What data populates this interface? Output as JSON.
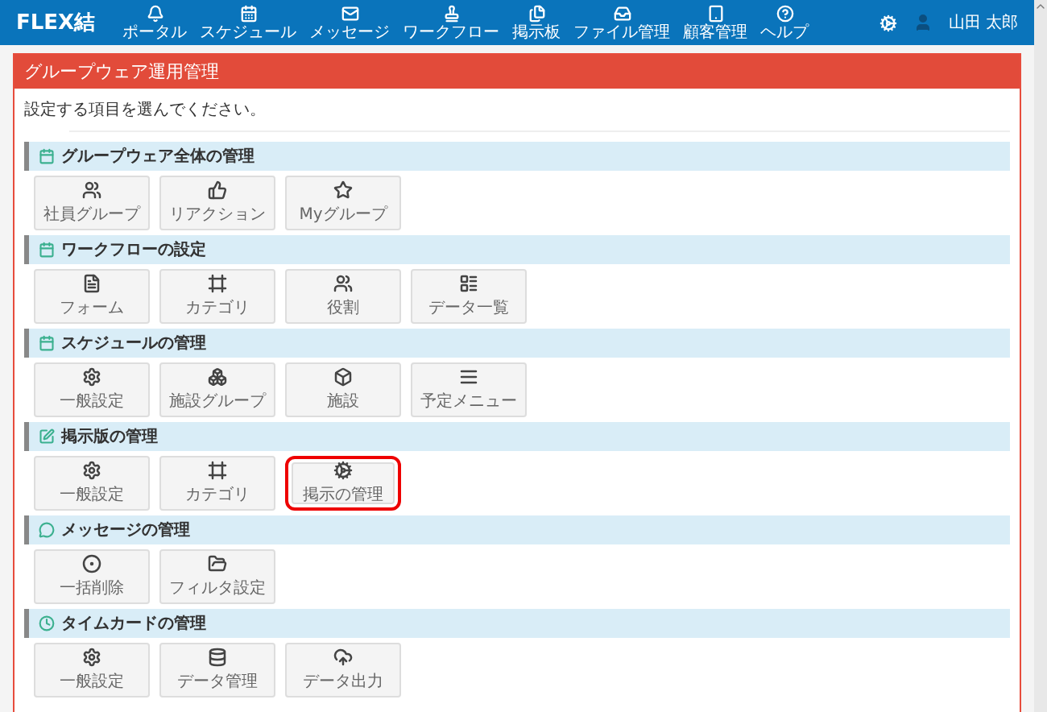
{
  "app": {
    "logo": "FLEX結",
    "user": "山田 太郎"
  },
  "nav": [
    {
      "label": "ポータル"
    },
    {
      "label": "スケジュール"
    },
    {
      "label": "メッセージ"
    },
    {
      "label": "ワークフロー"
    },
    {
      "label": "掲示板"
    },
    {
      "label": "ファイル管理"
    },
    {
      "label": "顧客管理"
    },
    {
      "label": "ヘルプ"
    }
  ],
  "panel": {
    "title": "グループウェア運用管理",
    "intro": "設定する項目を選んでください。"
  },
  "sections": [
    {
      "title": "グループウェア全体の管理",
      "items": [
        {
          "label": "社員グループ",
          "highlighted": false
        },
        {
          "label": "リアクション",
          "highlighted": false
        },
        {
          "label": "Myグループ",
          "highlighted": false
        }
      ]
    },
    {
      "title": "ワークフローの設定",
      "items": [
        {
          "label": "フォーム",
          "highlighted": false
        },
        {
          "label": "カテゴリ",
          "highlighted": false
        },
        {
          "label": "役割",
          "highlighted": false
        },
        {
          "label": "データ一覧",
          "highlighted": false
        }
      ]
    },
    {
      "title": "スケジュールの管理",
      "items": [
        {
          "label": "一般設定",
          "highlighted": false
        },
        {
          "label": "施設グループ",
          "highlighted": false
        },
        {
          "label": "施設",
          "highlighted": false
        },
        {
          "label": "予定メニュー",
          "highlighted": false
        }
      ]
    },
    {
      "title": "掲示版の管理",
      "items": [
        {
          "label": "一般設定",
          "highlighted": false
        },
        {
          "label": "カテゴリ",
          "highlighted": false
        },
        {
          "label": "掲示の管理",
          "highlighted": true
        }
      ]
    },
    {
      "title": "メッセージの管理",
      "items": [
        {
          "label": "一括削除",
          "highlighted": false
        },
        {
          "label": "フィルタ設定",
          "highlighted": false
        }
      ]
    },
    {
      "title": "タイムカードの管理",
      "items": [
        {
          "label": "一般設定",
          "highlighted": false
        },
        {
          "label": "データ管理",
          "highlighted": false
        },
        {
          "label": "データ出力",
          "highlighted": false
        }
      ]
    }
  ]
}
